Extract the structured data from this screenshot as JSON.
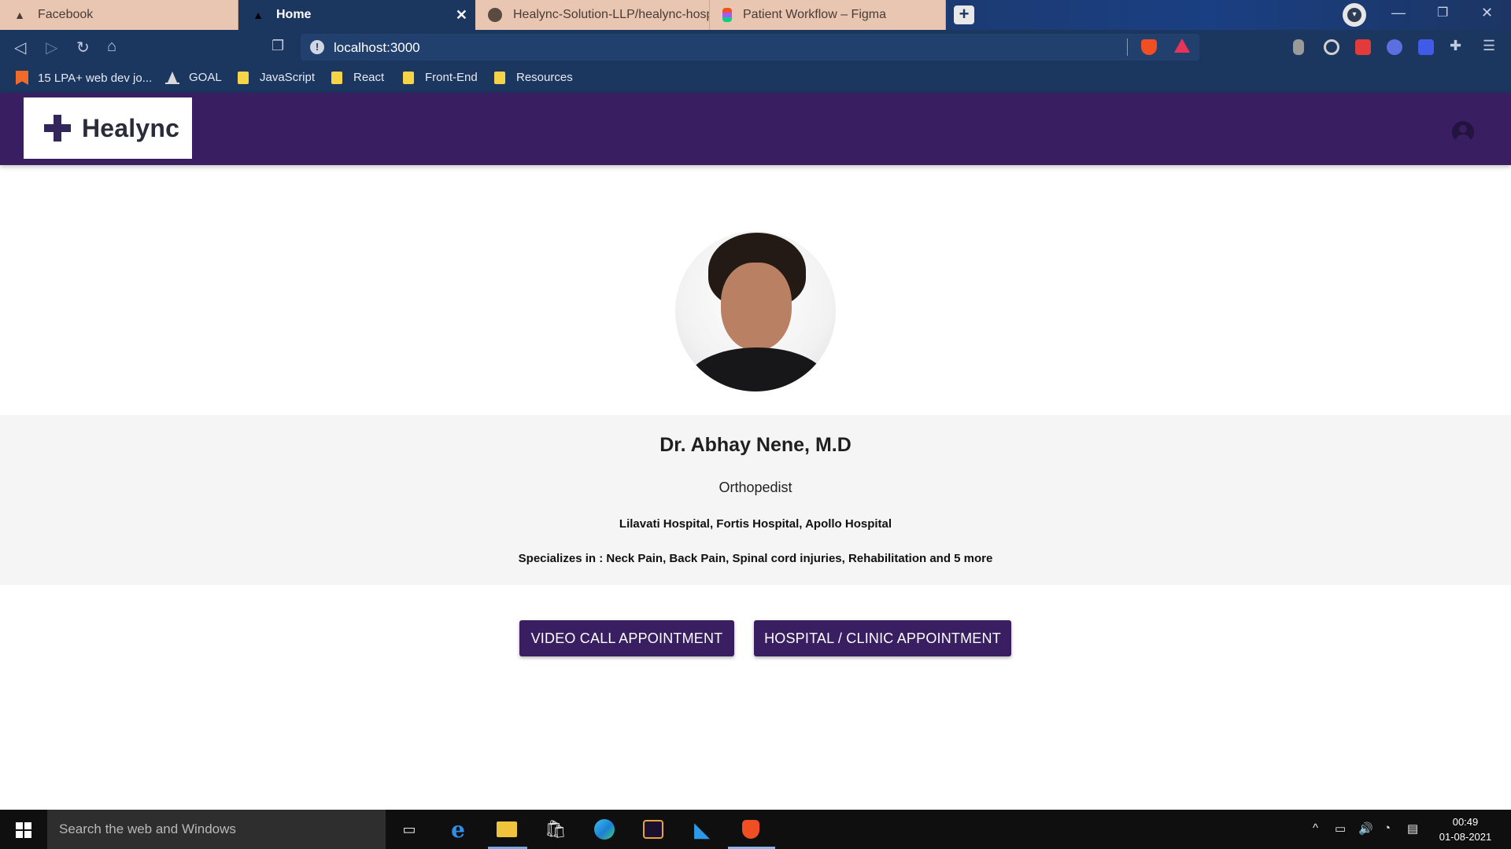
{
  "browser": {
    "tabs": [
      {
        "title": "Facebook",
        "active": false
      },
      {
        "title": "Home",
        "active": true
      },
      {
        "title": "Healync-Solution-LLP/healync-hospita",
        "active": false
      },
      {
        "title": "Patient Workflow – Figma",
        "active": false
      }
    ],
    "url": "localhost:3000",
    "bookmarks": [
      {
        "label": "15 LPA+ web dev jo..."
      },
      {
        "label": "GOAL"
      },
      {
        "label": "JavaScript"
      },
      {
        "label": "React"
      },
      {
        "label": "Front-End"
      },
      {
        "label": "Resources"
      }
    ]
  },
  "app": {
    "brand": "Healync",
    "colors": {
      "primary": "#3a1e62",
      "band": "#f5f5f5"
    },
    "doctor": {
      "name": "Dr. Abhay Nene, M.D",
      "specialty": "Orthopedist",
      "hospitals": "Lilavati Hospital, Fortis Hospital, Apollo Hospital",
      "specializations": "Specializes in : Neck Pain, Back Pain, Spinal cord injuries, Rehabilitation and 5 more"
    },
    "buttons": {
      "video": "VIDEO CALL APPOINTMENT",
      "clinic": "HOSPITAL / CLINIC APPOINTMENT"
    }
  },
  "taskbar": {
    "search_placeholder": "Search the web and Windows",
    "time": "00:49",
    "date": "01-08-2021"
  }
}
